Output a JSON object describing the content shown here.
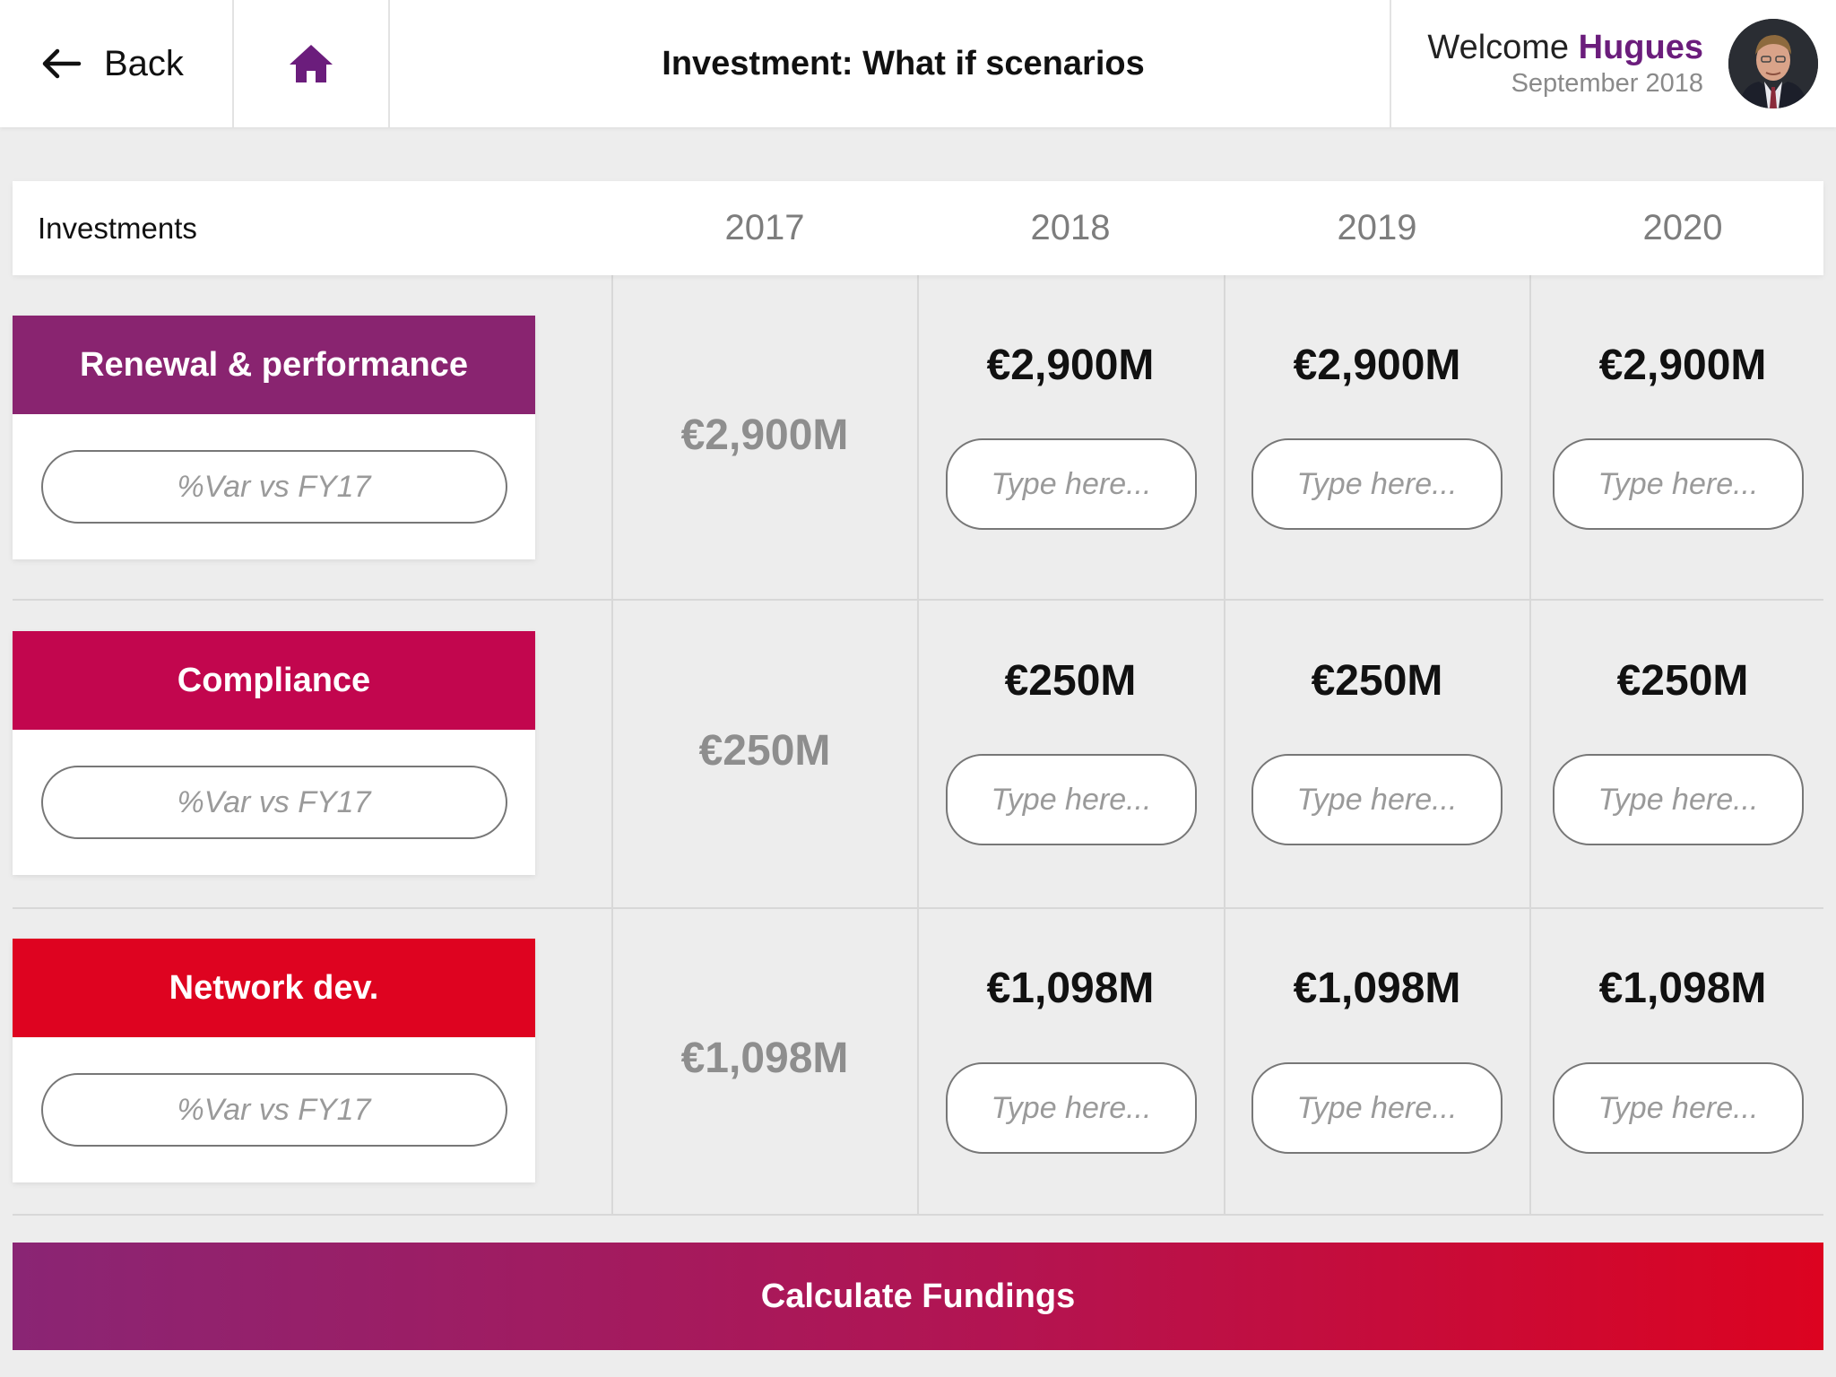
{
  "header": {
    "back_label": "Back",
    "title": "Investment: What if scenarios",
    "welcome_prefix": "Welcome",
    "user_name": "Hugues",
    "date": "September 2018"
  },
  "table": {
    "row_header_label": "Investments",
    "years": [
      "2017",
      "2018",
      "2019",
      "2020"
    ],
    "input_placeholder": "Type here...",
    "variation_placeholder": "%Var vs FY17",
    "rows": [
      {
        "category": "Renewal & performance",
        "color": "#892470",
        "values": [
          "€2,900M",
          "€2,900M",
          "€2,900M",
          "€2,900M"
        ]
      },
      {
        "category": "Compliance",
        "color": "#c2064e",
        "values": [
          "€250M",
          "€250M",
          "€250M",
          "€250M"
        ]
      },
      {
        "category": "Network dev.",
        "color": "#de0320",
        "values": [
          "€1,098M",
          "€1,098M",
          "€1,098M",
          "€1,098M"
        ]
      }
    ]
  },
  "actions": {
    "calculate_label": "Calculate Fundings"
  },
  "colors": {
    "accent_purple": "#6b1d7c",
    "gradient_start": "#8a2574",
    "gradient_end": "#dc0320"
  }
}
